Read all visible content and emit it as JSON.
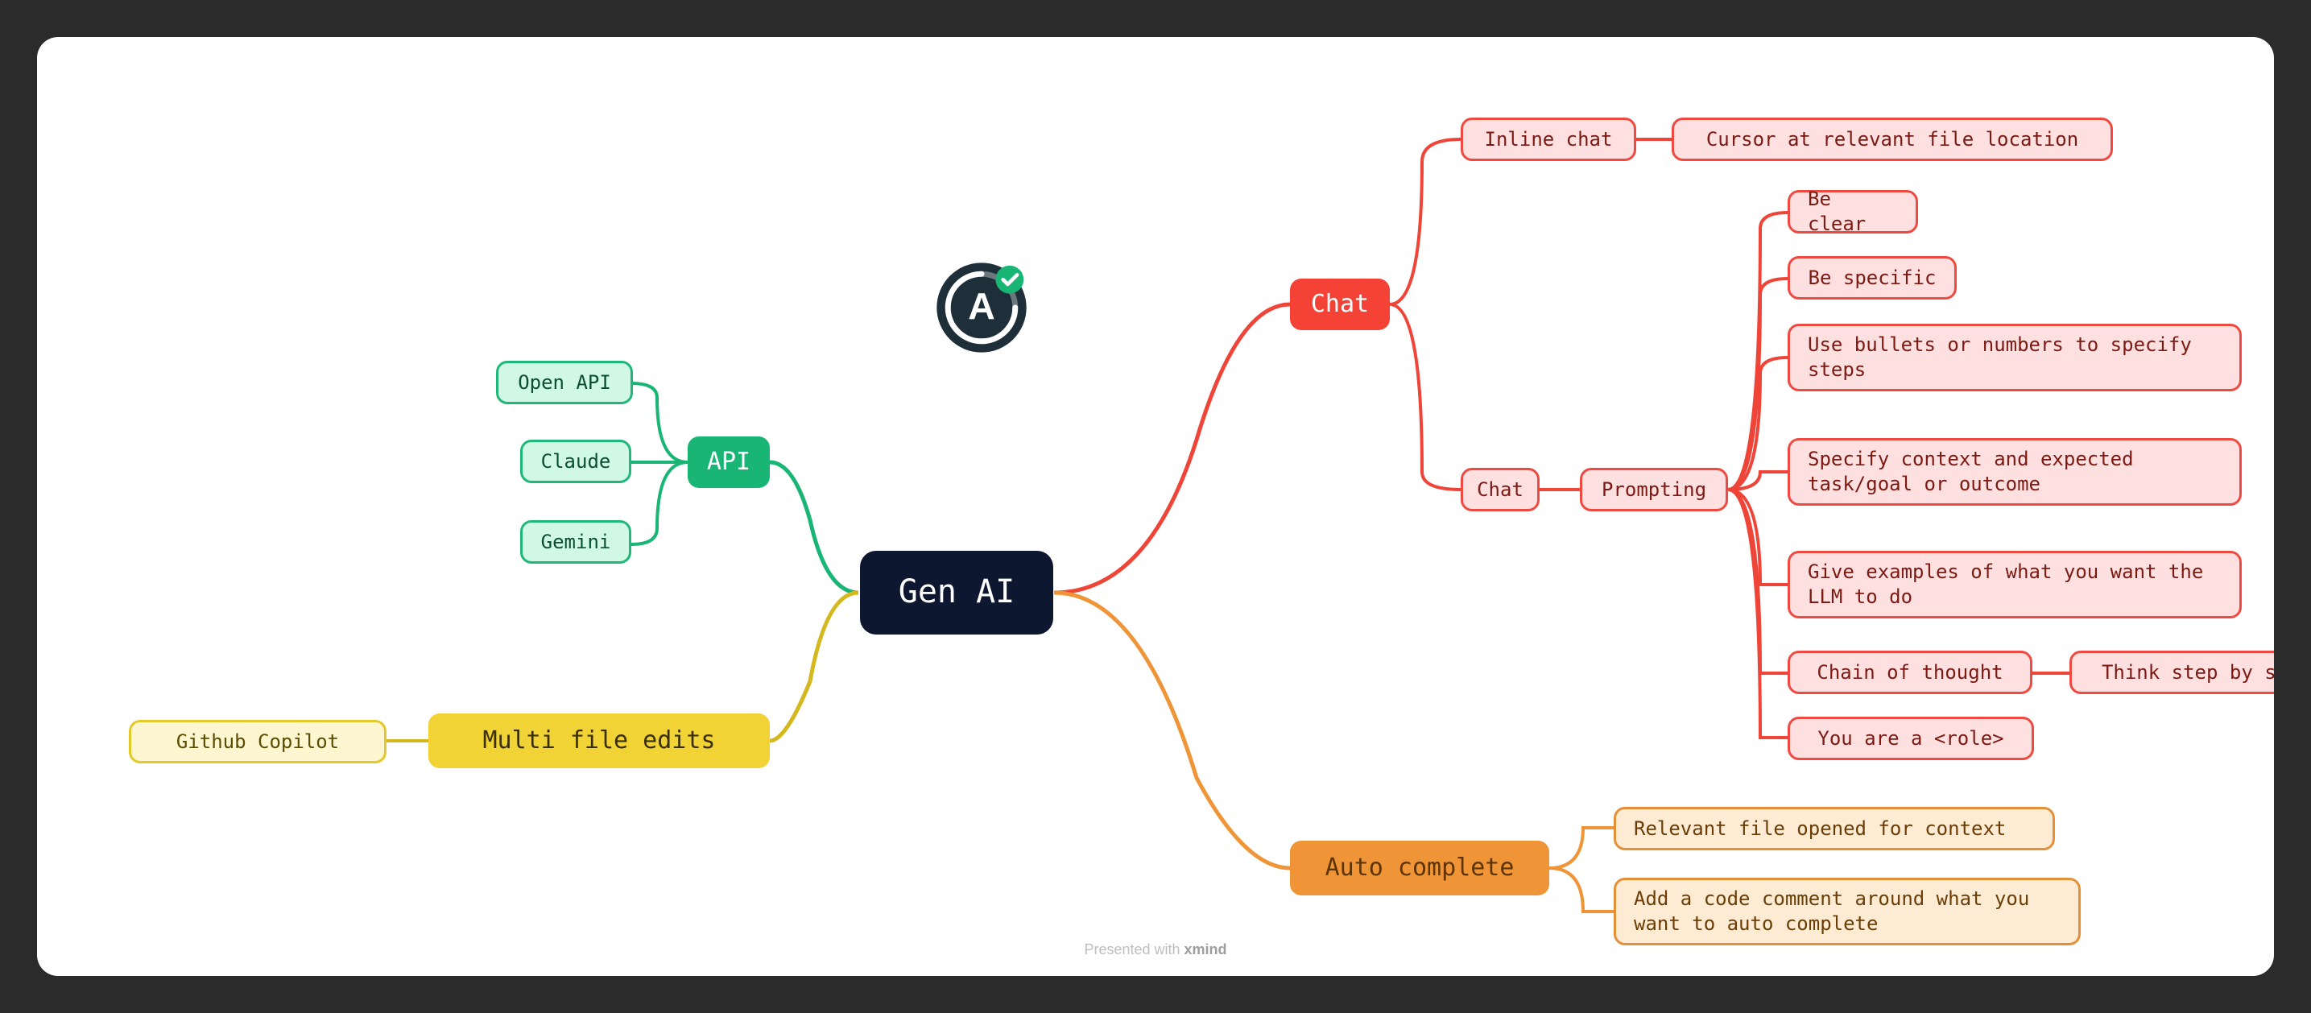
{
  "root": "Gen AI",
  "branches": {
    "chat": {
      "label": "Chat",
      "inline_chat": {
        "label": "Inline chat",
        "child": "Cursor at relevant file location"
      },
      "chat_sub": {
        "label": "Chat",
        "prompting": {
          "label": "Prompting",
          "tips": [
            "Be clear",
            "Be specific",
            "Use bullets or numbers to specify\nsteps",
            "Specify context and expected\ntask/goal or outcome",
            "Give examples of what you want the\nLLM to do",
            "Chain of thought",
            "You are a <role>"
          ],
          "chain_child": "Think step by step"
        }
      }
    },
    "api": {
      "label": "API",
      "providers": [
        "Open API",
        "Claude",
        "Gemini"
      ]
    },
    "multi": {
      "label": "Multi file edits",
      "child": "Github Copilot"
    },
    "auto": {
      "label": "Auto complete",
      "items": [
        "Relevant file opened for context",
        "Add a code comment around what you\nwant to auto complete"
      ]
    }
  },
  "footer": {
    "prefix": "Presented with ",
    "brand": "xmind"
  },
  "badge_name": "angular-logo-badge"
}
